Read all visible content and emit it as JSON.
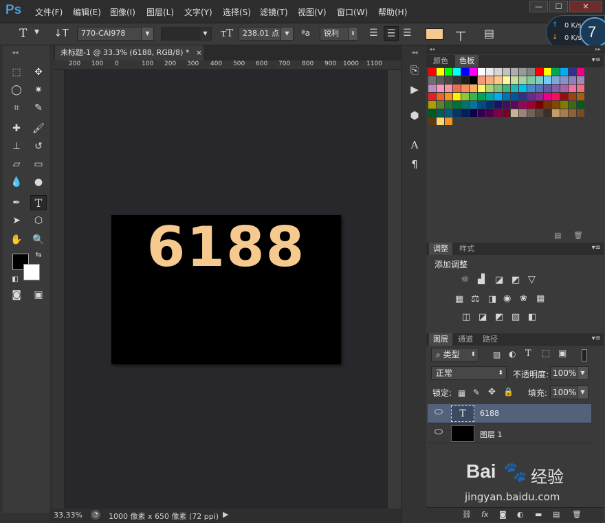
{
  "app": {
    "logo": "Ps"
  },
  "menu": [
    "文件(F)",
    "编辑(E)",
    "图像(I)",
    "图层(L)",
    "文字(Y)",
    "选择(S)",
    "滤镜(T)",
    "视图(V)",
    "窗口(W)",
    "帮助(H)"
  ],
  "window_controls": [
    "—",
    "☐",
    "✕"
  ],
  "options": {
    "font_family": "770-CAI978",
    "font_style": "",
    "font_size": "238.01 点",
    "antialias": "锐利",
    "swatch_color": "#f6c98f"
  },
  "network": {
    "up": "0 K/s",
    "down": "0 K/s",
    "badge": "7"
  },
  "document": {
    "tab_title": "未标题-1 @ 33.3% (6188, RGB/8) *",
    "close": "×",
    "canvas_text": "6188",
    "canvas_text_color": "#f6c98f",
    "ruler_ticks": [
      "200",
      "100",
      "0",
      "100",
      "200",
      "300",
      "400",
      "500",
      "600",
      "700",
      "800",
      "900",
      "1000",
      "1100"
    ]
  },
  "status": {
    "zoom": "33.33%",
    "doc_info": "1000 像素 x 650 像素 (72 ppi)"
  },
  "swatches_panel": {
    "tabs": [
      "颜色",
      "色板"
    ],
    "active": "色板",
    "colors": [
      "#ff0000",
      "#ffff00",
      "#00ff00",
      "#00ffff",
      "#0000ff",
      "#ff00ff",
      "#ffffff",
      "#ebebeb",
      "#d6d6d6",
      "#c2c2c2",
      "#adadad",
      "#999999",
      "#858585",
      "#ff0000",
      "#ffff00",
      "#00a651",
      "#00aeef",
      "#2e3192",
      "#ec008c",
      "#707070",
      "#5c5c5c",
      "#474747",
      "#333333",
      "#1f1f1f",
      "#000000",
      "#f7977a",
      "#f9ad81",
      "#fdc68a",
      "#fff79a",
      "#c4df9b",
      "#a3d39c",
      "#82ca9d",
      "#7bcdc8",
      "#6ecff6",
      "#7ea7d8",
      "#8493ca",
      "#8882be",
      "#a187be",
      "#bc8dbf",
      "#f49ac2",
      "#f6989d",
      "#f26c4f",
      "#f68e55",
      "#fbaf5c",
      "#fff467",
      "#acd372",
      "#7cc576",
      "#3bb878",
      "#1abbb4",
      "#00bff3",
      "#438ccb",
      "#5574b9",
      "#605ca8",
      "#855fa8",
      "#a763a8",
      "#f06ea9",
      "#f26d7d",
      "#ed1c24",
      "#f26522",
      "#f7941d",
      "#fff200",
      "#8dc73f",
      "#39b54a",
      "#00a651",
      "#00a99d",
      "#00aeef",
      "#0072bc",
      "#0054a6",
      "#2e3192",
      "#662d91",
      "#92278f",
      "#ec008c",
      "#ed145b",
      "#9e0b0f",
      "#a0410d",
      "#a36209",
      "#aba000",
      "#598527",
      "#1a7b30",
      "#007236",
      "#00746b",
      "#0076a3",
      "#004b80",
      "#003471",
      "#1b1464",
      "#440e62",
      "#630460",
      "#9e005d",
      "#9e0039",
      "#790000",
      "#7b2e00",
      "#7d4900",
      "#827b00",
      "#406618",
      "#005e20",
      "#005826",
      "#005952",
      "#005b7f",
      "#003663",
      "#002157",
      "#0d004c",
      "#32004b",
      "#4b0049",
      "#7b0046",
      "#7a0026",
      "#c7b299",
      "#998675",
      "#736357",
      "#534741",
      "#37302d",
      "#c69c6d",
      "#a67c52",
      "#8c6239",
      "#754c24",
      "#603913",
      "#fbd96f",
      "#f7941d"
    ]
  },
  "adjustments_panel": {
    "tabs": [
      "调整",
      "样式"
    ],
    "active": "调整",
    "title": "添加调整"
  },
  "layers_panel": {
    "tabs": [
      "图层",
      "通道",
      "路径"
    ],
    "active": "图层",
    "filter_kind": "类型",
    "blend_mode": "正常",
    "opacity_label": "不透明度:",
    "opacity": "100%",
    "lock_label": "锁定:",
    "fill_label": "填充:",
    "fill": "100%",
    "layers": [
      {
        "name": "6188",
        "type": "text",
        "selected": true
      },
      {
        "name": "图层 1",
        "type": "fill",
        "selected": false
      }
    ]
  },
  "watermark": {
    "brand": "Bai",
    "brand_tail": "经验",
    "url": "jingyan.baidu.com"
  }
}
